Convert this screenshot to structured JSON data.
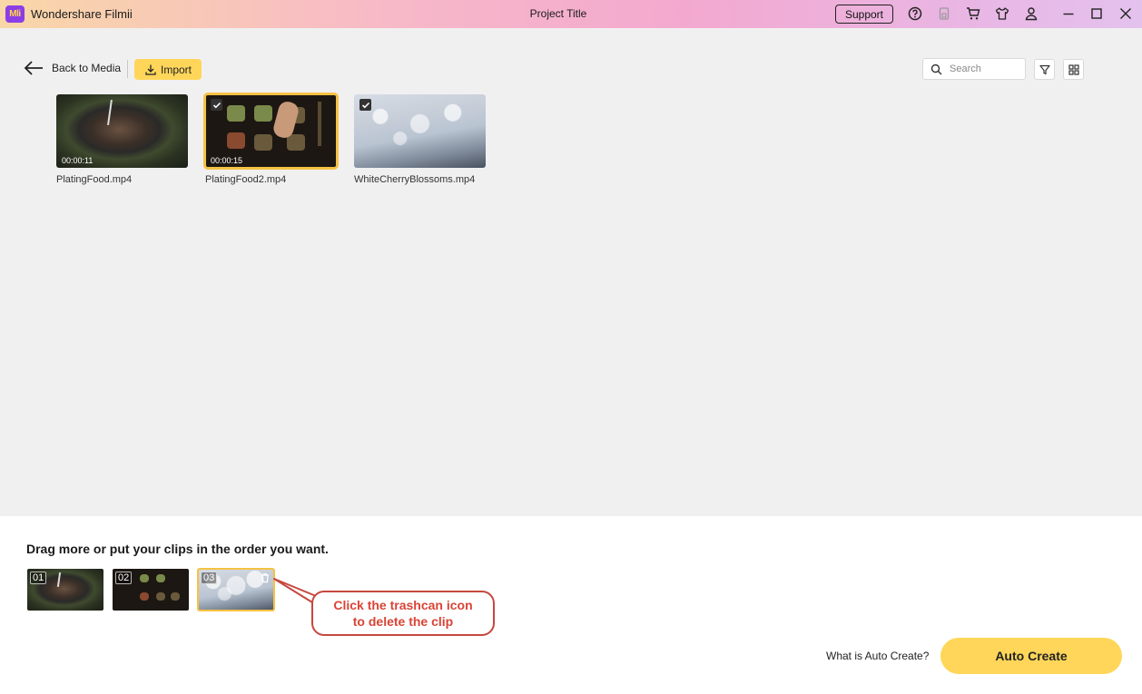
{
  "app": {
    "logo_text": "Mli",
    "name": "Wondershare Filmii",
    "project_title": "Project Title",
    "support_label": "Support",
    "titlebar_icons": [
      "help-icon",
      "save-icon",
      "cart-icon",
      "shirt-icon",
      "user-icon",
      "minimize-icon",
      "maximize-icon",
      "close-icon"
    ]
  },
  "toolbar": {
    "back_label": "Back to Media",
    "import_label": "Import",
    "search_placeholder": "Search"
  },
  "media": [
    {
      "name": "PlatingFood.mp4",
      "duration": "00:00:11",
      "selected": false
    },
    {
      "name": "PlatingFood2.mp4",
      "duration": "00:00:15",
      "selected": true
    },
    {
      "name": "WhiteCherryBlossoms.mp4",
      "duration": "",
      "selected": true
    }
  ],
  "timeline": {
    "title": "Drag more or put your clips in the order you want.",
    "clips": [
      {
        "num": "01"
      },
      {
        "num": "02"
      },
      {
        "num": "03"
      }
    ]
  },
  "callout": {
    "line1": "Click the trashcan icon",
    "line2": "to delete the clip"
  },
  "footer": {
    "what_is_label": "What is Auto Create?",
    "auto_create_label": "Auto Create"
  },
  "colors": {
    "accent": "#ffd65a",
    "selection_outline": "#f6c244",
    "callout_red": "#d94436"
  }
}
